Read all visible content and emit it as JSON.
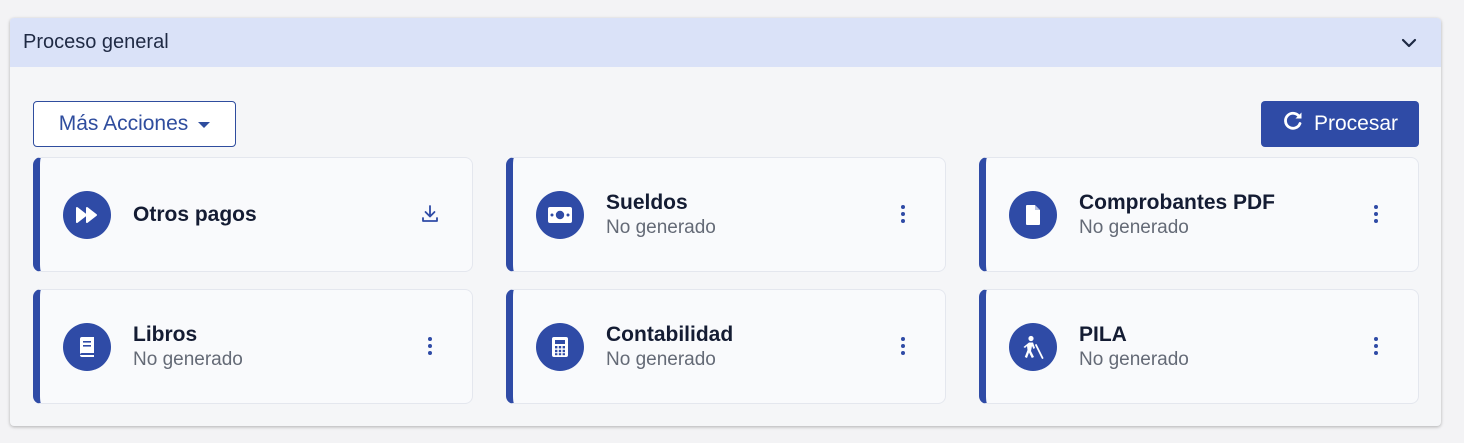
{
  "panel": {
    "title": "Proceso general"
  },
  "actions": {
    "more_label": "Más Acciones",
    "process_label": "Procesar"
  },
  "cards": [
    {
      "title": "Otros pagos",
      "status": "",
      "icon": "fast-forward-icon",
      "action_icon": "download-icon"
    },
    {
      "title": "Sueldos",
      "status": "No generado",
      "icon": "money-bill-icon",
      "action_icon": "kebab-menu-icon"
    },
    {
      "title": "Comprobantes PDF",
      "status": "No generado",
      "icon": "file-icon",
      "action_icon": "kebab-menu-icon"
    },
    {
      "title": "Libros",
      "status": "No generado",
      "icon": "book-icon",
      "action_icon": "kebab-menu-icon"
    },
    {
      "title": "Contabilidad",
      "status": "No generado",
      "icon": "calculator-icon",
      "action_icon": "kebab-menu-icon"
    },
    {
      "title": "PILA",
      "status": "No generado",
      "icon": "person-walking-icon",
      "action_icon": "kebab-menu-icon"
    }
  ],
  "colors": {
    "primary": "#2f4ba6",
    "header_bg": "#dae2f8",
    "panel_bg": "#f5f6f8"
  }
}
